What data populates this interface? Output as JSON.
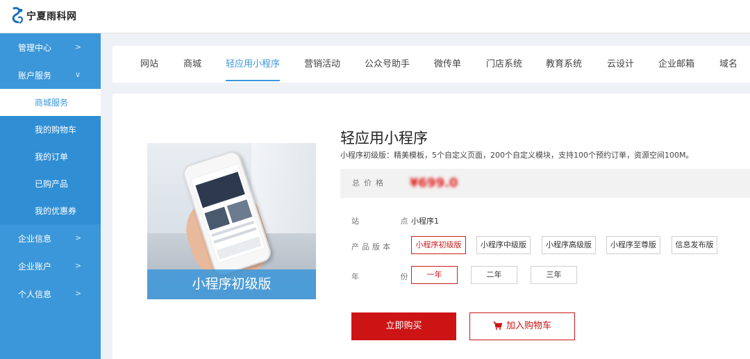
{
  "header": {
    "site_name": "宁夏雨科网"
  },
  "sidebar": {
    "items": [
      {
        "label": "管理中心",
        "chevron": ">"
      },
      {
        "label": "账户服务",
        "chevron": "∨"
      }
    ],
    "sub_items": [
      {
        "label": "商城服务",
        "active": true
      },
      {
        "label": "我的购物车"
      },
      {
        "label": "我的订单"
      },
      {
        "label": "已购产品"
      },
      {
        "label": "我的优惠券"
      }
    ],
    "bottom_items": [
      {
        "label": "企业信息",
        "chevron": ">"
      },
      {
        "label": "企业账户",
        "chevron": ">"
      },
      {
        "label": "个人信息",
        "chevron": ">"
      }
    ]
  },
  "tabs": [
    {
      "label": "网站"
    },
    {
      "label": "商城"
    },
    {
      "label": "轻应用小程序",
      "active": true
    },
    {
      "label": "营销活动"
    },
    {
      "label": "公众号助手"
    },
    {
      "label": "微传单"
    },
    {
      "label": "门店系统"
    },
    {
      "label": "教育系统"
    },
    {
      "label": "云设计"
    },
    {
      "label": "企业邮箱"
    },
    {
      "label": "域名"
    }
  ],
  "product": {
    "image_caption": "小程序初级版",
    "title": "轻应用小程序",
    "subtitle": "小程序初级版：精美模板，5个自定义页面，200个自定义模块，支持100个预约订单，资源空间100M。",
    "price_label": "总价格",
    "price_value": "¥699.0",
    "site_label": "站 点",
    "site_value": "小程序1",
    "edition_label": "产品版本",
    "editions": [
      "小程序初级版",
      "小程序中级版",
      "小程序高级版",
      "小程序至尊版",
      "信息发布版"
    ],
    "selected_edition": "小程序初级版",
    "year_label": "年 份",
    "years": [
      "一年",
      "二年",
      "三年"
    ],
    "selected_year": "一年",
    "buy_label": "立即购买",
    "cart_label": "加入购物车"
  },
  "colors": {
    "sidebar": "#3b97d9",
    "accent": "#3b97d9",
    "price": "#e02020",
    "buy": "#cc1414"
  }
}
